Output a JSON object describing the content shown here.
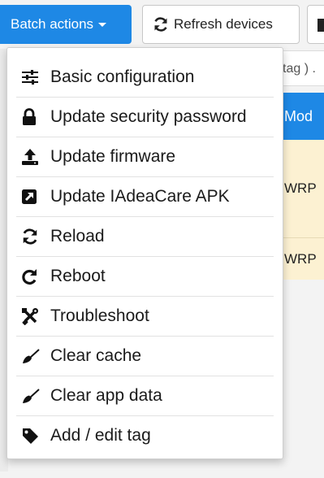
{
  "toolbar": {
    "batch_label": "Batch actions",
    "refresh_label": "Refresh devices"
  },
  "search": {
    "hint": "tag ) ."
  },
  "table": {
    "header_partial": "Mod",
    "rows": [
      {
        "model_partial": "WRP"
      },
      {
        "model_partial": "WRP"
      }
    ]
  },
  "menu": {
    "items": [
      {
        "label": "Basic configuration",
        "icon": "sliders-icon"
      },
      {
        "label": "Update security password",
        "icon": "lock-icon"
      },
      {
        "label": "Update firmware",
        "icon": "upload-icon"
      },
      {
        "label": "Update IAdeaCare APK",
        "icon": "external-link-icon"
      },
      {
        "label": "Reload",
        "icon": "refresh-icon"
      },
      {
        "label": "Reboot",
        "icon": "redo-icon"
      },
      {
        "label": "Troubleshoot",
        "icon": "tools-icon"
      },
      {
        "label": "Clear cache",
        "icon": "broom-icon"
      },
      {
        "label": "Clear app data",
        "icon": "broom-icon"
      },
      {
        "label": "Add / edit tag",
        "icon": "tag-icon"
      }
    ]
  },
  "colors": {
    "accent": "#1e88e5",
    "row_highlight": "#fcf1d2"
  }
}
